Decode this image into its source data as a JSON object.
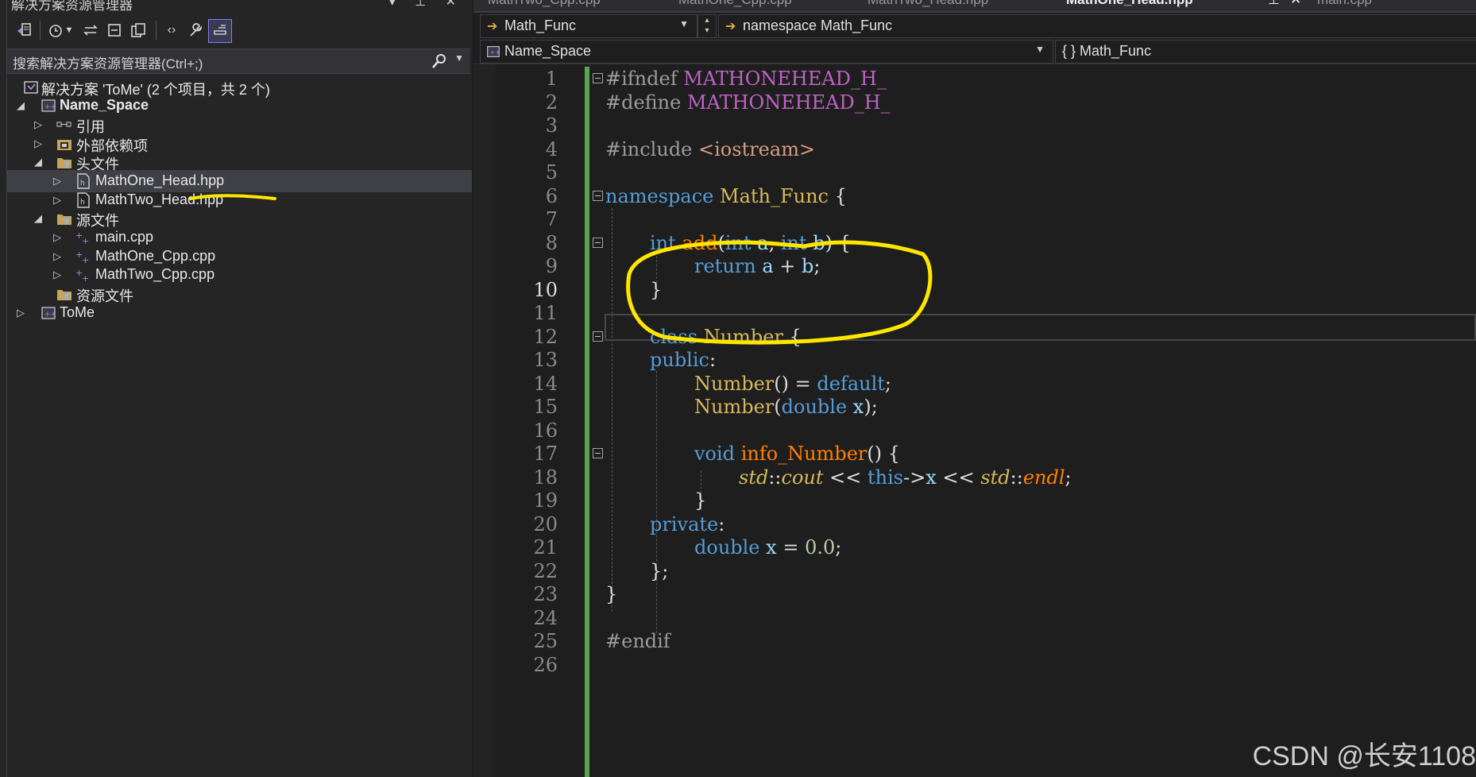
{
  "solution_explorer": {
    "title": "解决方案资源管理器",
    "title_controls": "▾ ⊥ ✕",
    "search_placeholder": "搜索解决方案资源管理器(Ctrl+;)",
    "tree": [
      {
        "label": "解决方案 'ToMe' (2 个项目，共 2 个)",
        "icon": "solution-icon"
      },
      {
        "label": "Name_Space",
        "icon": "cpp-project-icon"
      },
      {
        "label": "引用",
        "icon": "references-icon"
      },
      {
        "label": "外部依赖项",
        "icon": "external-deps-icon"
      },
      {
        "label": "头文件",
        "icon": "filter-folder-icon"
      },
      {
        "label": "MathOne_Head.hpp",
        "icon": "header-file-icon"
      },
      {
        "label": "MathTwo_Head.hpp",
        "icon": "header-file-icon"
      },
      {
        "label": "源文件",
        "icon": "filter-folder-icon"
      },
      {
        "label": "main.cpp",
        "icon": "cpp-file-icon"
      },
      {
        "label": "MathOne_Cpp.cpp",
        "icon": "cpp-file-icon"
      },
      {
        "label": "MathTwo_Cpp.cpp",
        "icon": "cpp-file-icon"
      },
      {
        "label": "资源文件",
        "icon": "filter-folder-icon"
      },
      {
        "label": "ToMe",
        "icon": "cpp-project-icon"
      }
    ]
  },
  "tabs": [
    "MathTwo_Cpp.cpp",
    "MathOne_Cpp.cpp",
    "MathTwo_Head.hpp",
    "MathOne_Head.hpp",
    "main.cpp"
  ],
  "nav": {
    "project_scope": "Math_Func",
    "namespace_scope": "namespace Math_Func",
    "project": "Name_Space",
    "member": "{ } Math_Func"
  },
  "editor": {
    "line_numbers": [
      "1",
      "2",
      "3",
      "4",
      "5",
      "6",
      "7",
      "8",
      "9",
      "10",
      "11",
      "12",
      "13",
      "14",
      "15",
      "16",
      "17",
      "18",
      "19",
      "20",
      "21",
      "22",
      "23",
      "24",
      "25",
      "26"
    ],
    "current_line": "10",
    "lines": {
      "l1": [
        "#ifndef ",
        "MATHONEHEAD_H_"
      ],
      "l2": [
        "#define ",
        "MATHONEHEAD_H_"
      ],
      "l4": [
        "#include ",
        "<iostream>"
      ],
      "l6": [
        "namespace",
        " Math_Func ",
        "{"
      ],
      "l8": [
        "int",
        " ",
        "add",
        "(",
        "int",
        " a",
        ", ",
        "int",
        " b",
        ")",
        " {"
      ],
      "l9": [
        "return",
        " a ",
        "+",
        " b",
        ";"
      ],
      "l10": [
        "}"
      ],
      "l12": [
        "class",
        " ",
        "Number",
        " {"
      ],
      "l13": [
        "public",
        ":"
      ],
      "l14": [
        "Number",
        "()",
        " = ",
        "default",
        ";"
      ],
      "l15": [
        "Number",
        "(",
        "double",
        " x",
        ");"
      ],
      "l17": [
        "void",
        " ",
        "info_Number",
        "()",
        " {"
      ],
      "l18": [
        "std",
        "::",
        "cout",
        " << ",
        "this",
        "->",
        "x",
        " << ",
        "std",
        "::",
        "endl",
        ";"
      ],
      "l19": [
        "}"
      ],
      "l20": [
        "private",
        ":"
      ],
      "l21": [
        "double",
        " x",
        " = ",
        "0.0",
        ";"
      ],
      "l22": [
        "};"
      ],
      "l23": [
        "}"
      ],
      "l25": [
        "#endif"
      ]
    }
  },
  "watermark": "CSDN @长安1108",
  "annotation_color": "#ffe600"
}
